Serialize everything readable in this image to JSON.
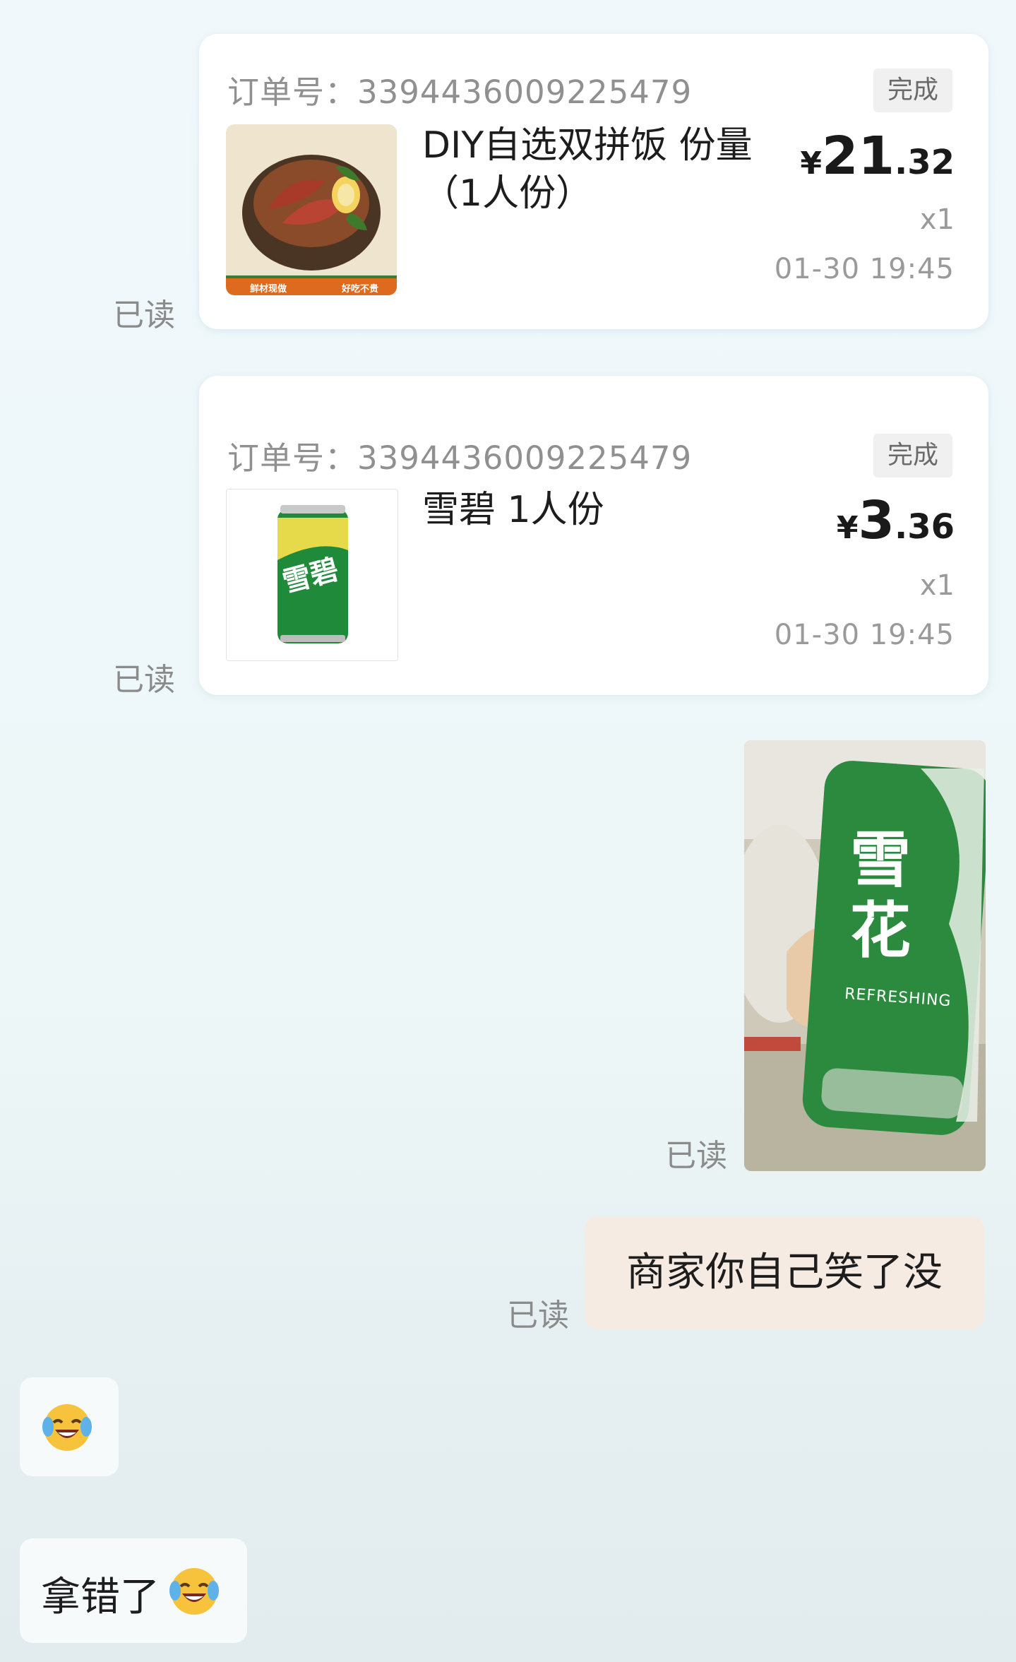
{
  "orders": [
    {
      "order_label": "订单号：",
      "order_number": "3394436009225479",
      "status": "完成",
      "product_name": "DIY自选双拼饭 份量（1人份）",
      "price_symbol": "¥",
      "price_int": "21",
      "price_dec": ".32",
      "quantity": "x1",
      "time": "01-30 19:45",
      "thumb_banner_left": "鲜材现做",
      "thumb_banner_right": "好吃不贵",
      "read": "已读"
    },
    {
      "order_label": "订单号：",
      "order_number": "3394436009225479",
      "status": "完成",
      "product_name": "雪碧 1人份",
      "price_symbol": "¥",
      "price_int": "3",
      "price_dec": ".36",
      "quantity": "x1",
      "time": "01-30 19:45",
      "can_text": "雪碧",
      "read": "已读"
    }
  ],
  "photo_message": {
    "can_text": "雪花",
    "can_subtext": "REFRESHING",
    "read": "已读"
  },
  "text_message_sent": {
    "text": "商家你自己笑了没",
    "read": "已读"
  },
  "received": {
    "emoji_only": "😂",
    "text": "拿错了"
  },
  "colors": {
    "sprite_green": "#1f8a3a",
    "sprite_yellow": "#e6d94a",
    "snow_green": "#2b8a3e",
    "thumb_orange": "#dd6a1e",
    "sent_bubble": "#f6ebe2"
  },
  "icons": [
    "laughing-crying-emoji-icon"
  ]
}
